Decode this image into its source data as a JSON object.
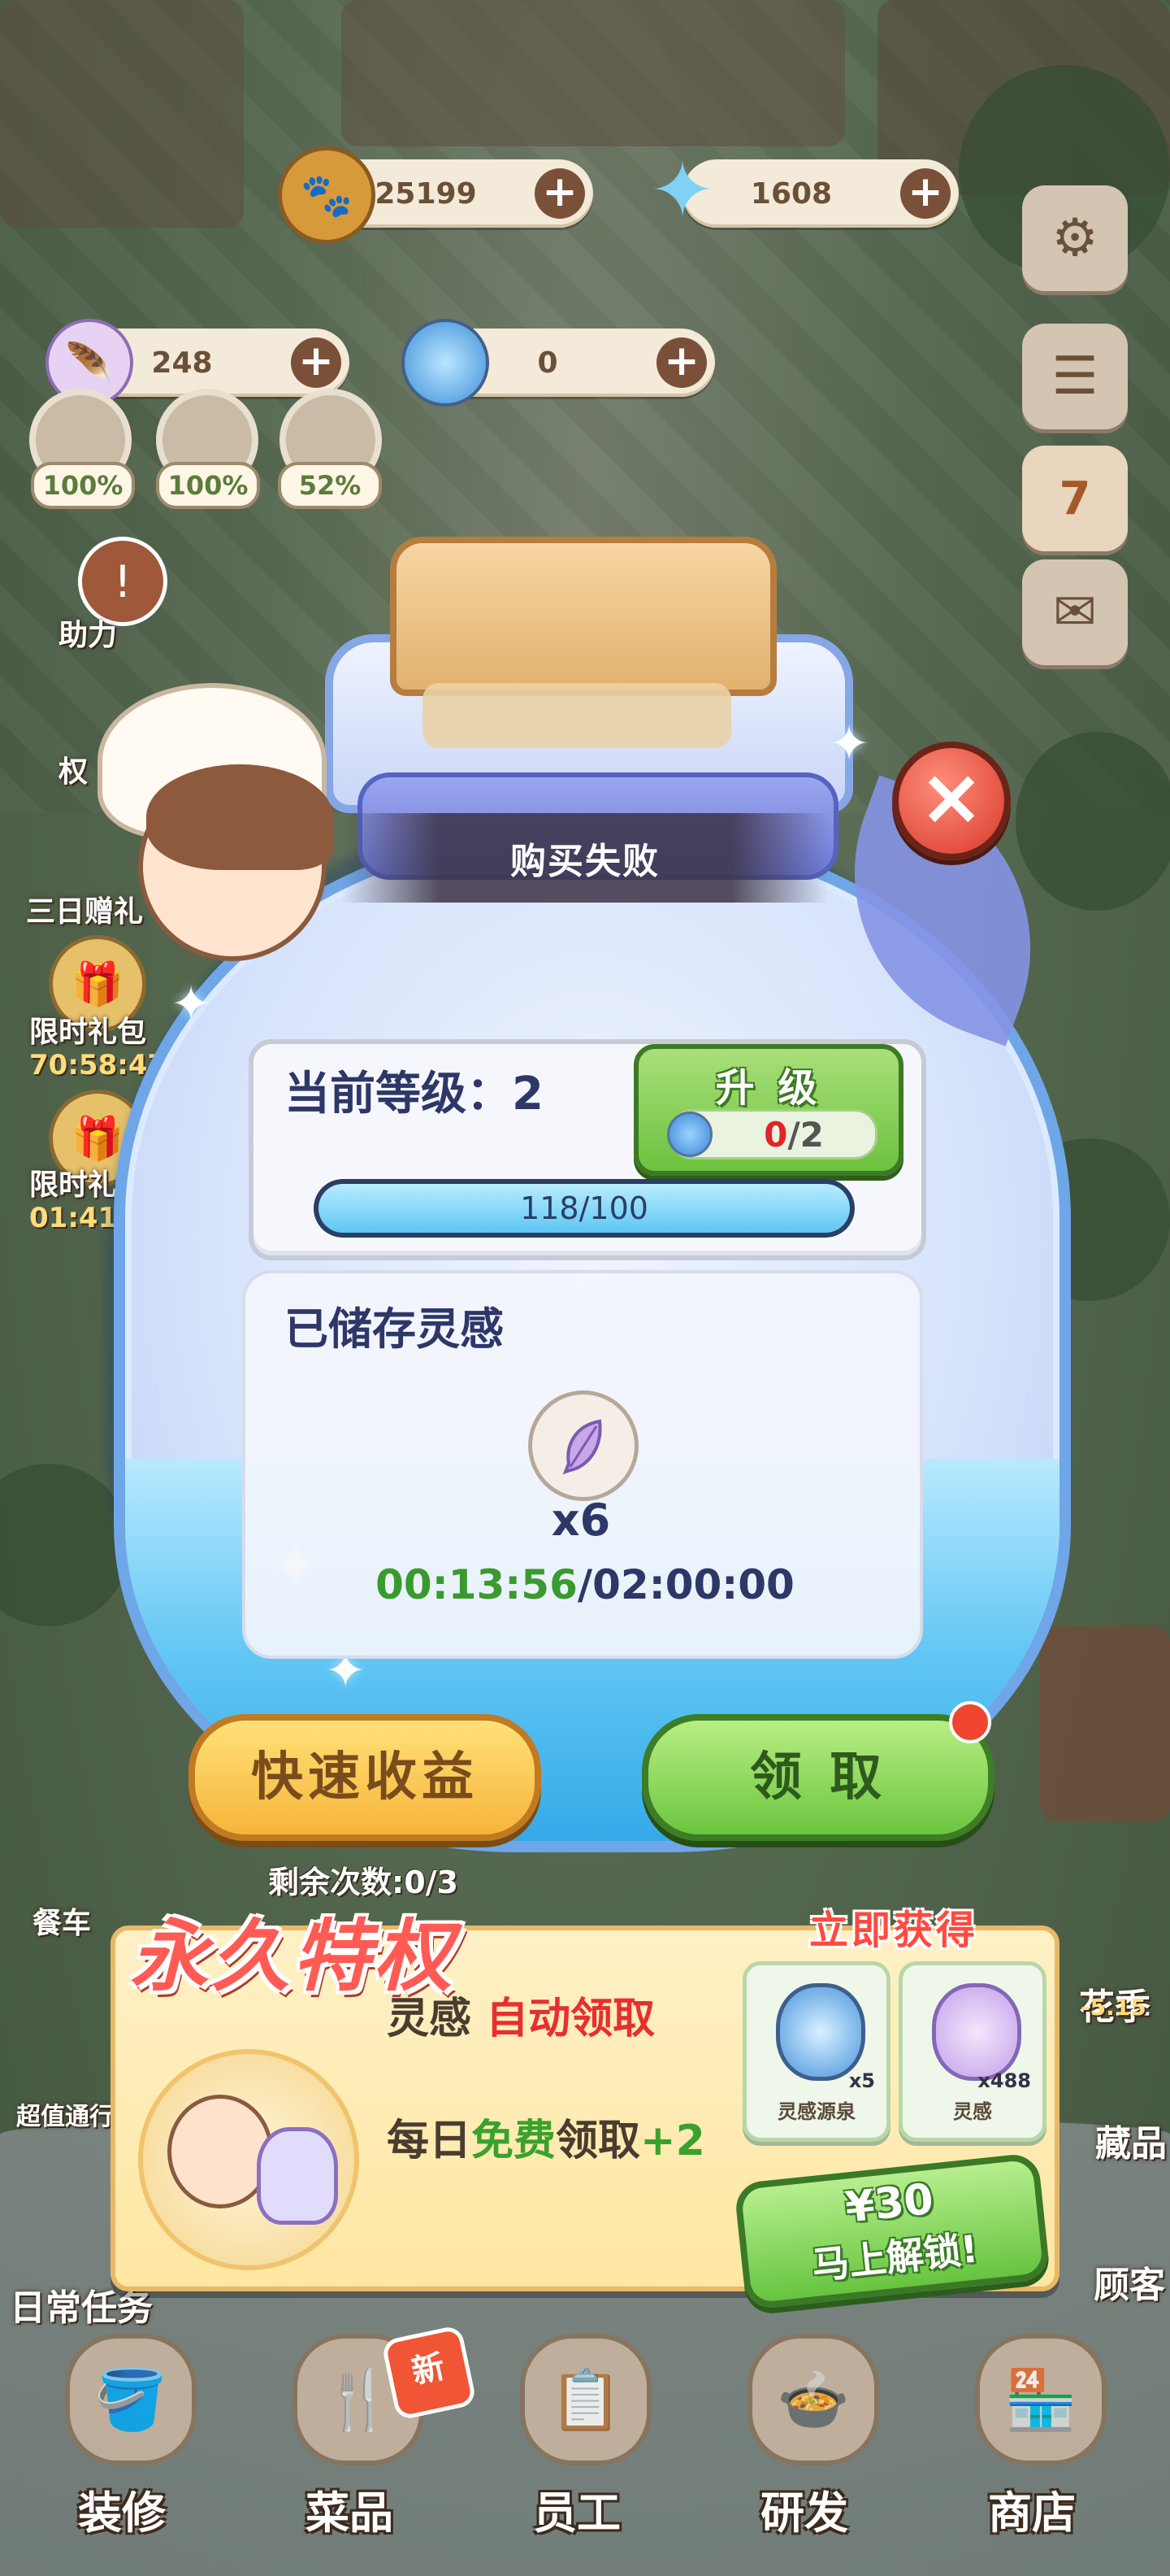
{
  "hud": {
    "coins": "25199",
    "gems": "1608",
    "feathers": "248",
    "bottles": "0",
    "stats": [
      "100%",
      "100%",
      "52%"
    ]
  },
  "left_menu": {
    "assist": "助力",
    "rights": "权",
    "three_day_gift": "三日赠礼",
    "limited_gift_1": "限时礼包",
    "limited_timer_1": "70:58:47",
    "limited_gift_2": "限时礼包",
    "limited_timer_2": "01:41:30",
    "value_pass": "超值通行",
    "daily_tasks": "日常任务",
    "restaurant": "餐车"
  },
  "right_menu": {
    "calendar_day": "7",
    "flower_season": "花季",
    "flower_dates": "-5.15",
    "collection": "藏品",
    "customers": "顾客"
  },
  "modal": {
    "title": "购买失败",
    "level_label": "当前等级：2",
    "upgrade": {
      "label": "升 级",
      "have": "0",
      "need": "/2"
    },
    "exp": {
      "text": "118/100",
      "fraction": 1.0
    },
    "stored_title": "已储存灵感",
    "feather_qty": "x6",
    "timer_elapsed": "00:13:56",
    "timer_total": "/02:00:00",
    "quick_button": "快速收益",
    "collect_button": "领 取",
    "remaining": "剩余次数:0/3"
  },
  "privilege": {
    "title": "永久特权",
    "get_now": "立即获得",
    "line1_prefix": "灵感",
    "line1_highlight": "自动领取",
    "line2_prefix": "每日",
    "line2_free": "免费",
    "line2_mid": "领取",
    "line2_bonus": "+2",
    "rewards": [
      {
        "name": "灵感源泉",
        "qty": "x5"
      },
      {
        "name": "灵感",
        "qty": "x488"
      }
    ],
    "price": "¥30",
    "unlock": "马上解锁!"
  },
  "nav": {
    "items": [
      {
        "label": "装修"
      },
      {
        "label": "菜品"
      },
      {
        "label": "员工"
      },
      {
        "label": "研发"
      },
      {
        "label": "商店"
      }
    ],
    "new_badge": "新"
  },
  "colors": {
    "accent_green": "#6cc23e",
    "accent_orange": "#f6b53b",
    "timer_green": "#3a9a2e",
    "alert_red": "#e2242a"
  }
}
